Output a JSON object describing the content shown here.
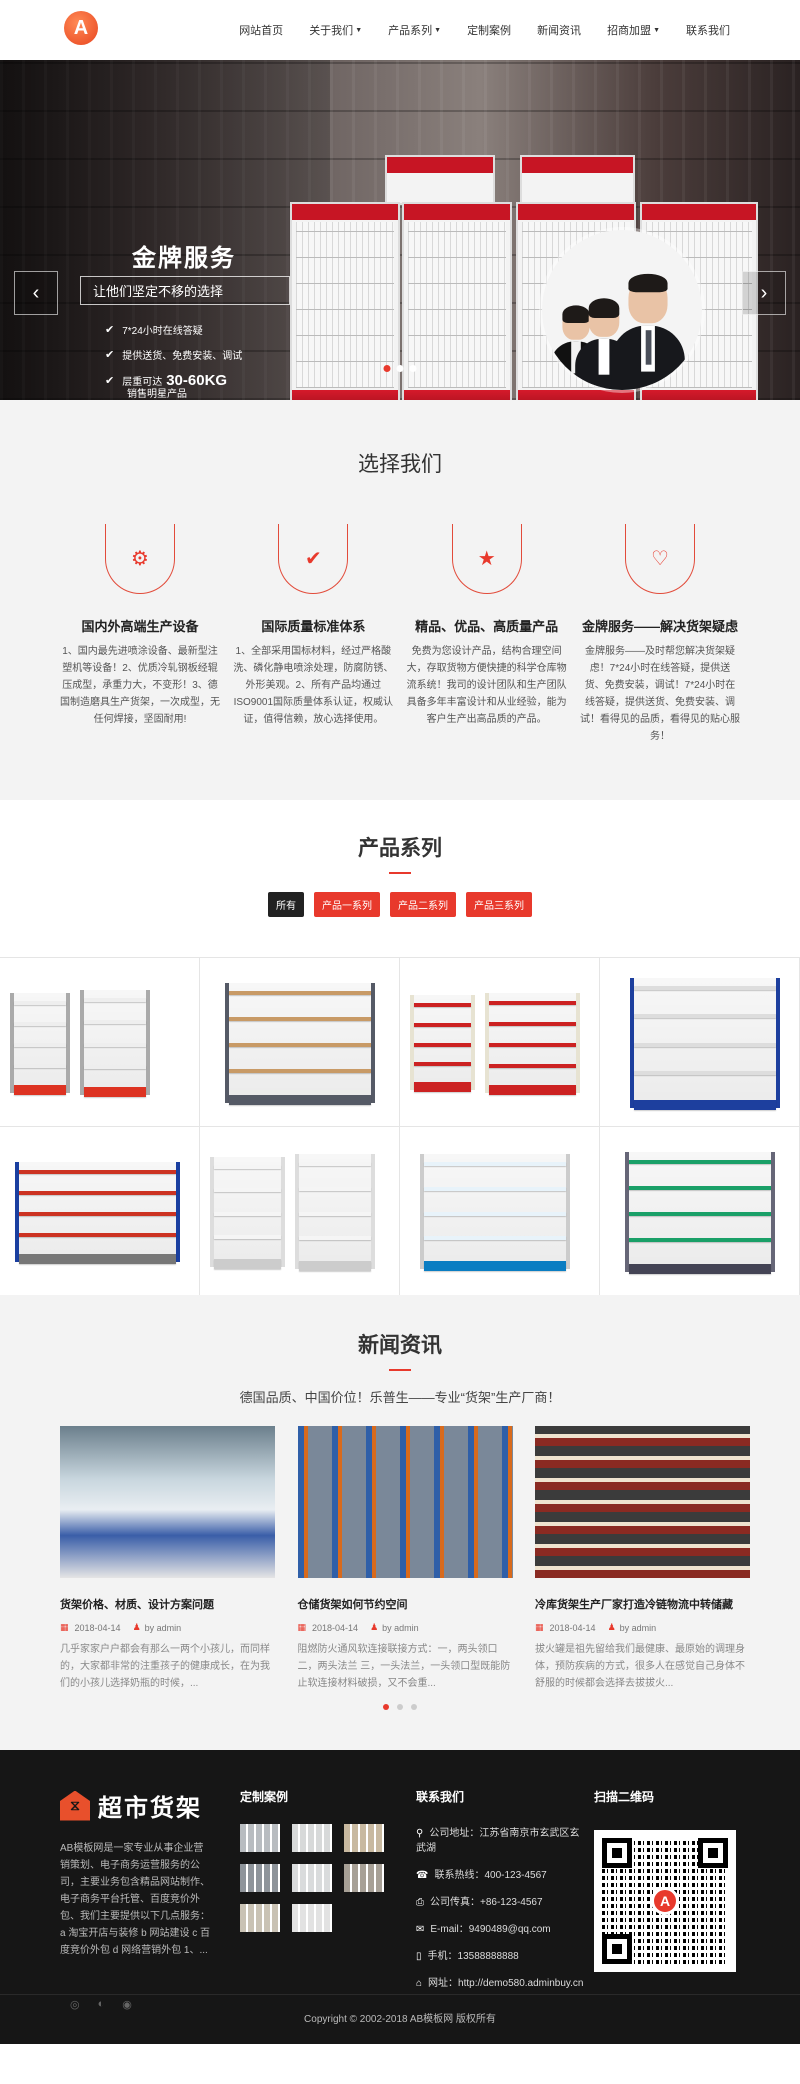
{
  "header": {
    "logo_text": "A",
    "nav": [
      {
        "label": "网站首页",
        "dropdown": false
      },
      {
        "label": "关于我们",
        "dropdown": true
      },
      {
        "label": "产品系列",
        "dropdown": true
      },
      {
        "label": "定制案例",
        "dropdown": false
      },
      {
        "label": "新闻资讯",
        "dropdown": false
      },
      {
        "label": "招商加盟",
        "dropdown": true
      },
      {
        "label": "联系我们",
        "dropdown": false
      }
    ]
  },
  "banner": {
    "title": "金牌服务",
    "subtitle": "让他们坚定不移的选择",
    "points": [
      "7*24小时在线答疑",
      "提供送货、免费安装、调试"
    ],
    "weight_prefix": "层重可达",
    "weight_value": "30-60KG",
    "weight_note": "销售明星产品",
    "prev_icon": "‹",
    "next_icon": "›",
    "slide_count": 3,
    "active_slide": 1
  },
  "choose": {
    "title": "选择我们",
    "items": [
      {
        "icon": "gears-icon",
        "glyph": "⚙",
        "title": "国内外高端生产设备",
        "text": "1、国内最先进喷涂设备、最新型注塑机等设备！2、优质冷轧钢板经辊压成型，承重力大，不变形！3、德国制造磨具生产货架，一次成型，无任何焊接，坚固耐用!"
      },
      {
        "icon": "check-square-icon",
        "glyph": "✔",
        "title": "国际质量标准体系",
        "text": "1、全部采用国标材料，经过严格酸洗、磷化静电喷涂处理，防腐防锈、外形美观。2、所有产品均通过ISO9001国际质量体系认证，权威认证，值得信赖，放心选择使用。"
      },
      {
        "icon": "star-icon",
        "glyph": "★",
        "title": "精品、优品、高质量产品",
        "text": "免费为您设计产品，结构合理空间大，存取货物方便快捷的科学仓库物流系统！我司的设计团队和生产团队具备多年丰富设计和从业经验，能为客户生产出高品质的产品。"
      },
      {
        "icon": "heart-icon",
        "glyph": "♡",
        "title": "金牌服务——解决货架疑虑",
        "text": "金牌服务——及时帮您解决货架疑虑！7*24小时在线答疑，提供送货、免费安装，调试！7*24小时在线答疑，提供送货、免费安装、调试！看得见的品质，看得见的贴心服务！"
      }
    ]
  },
  "products": {
    "title": "产品系列",
    "filters": [
      "所有",
      "产品一系列",
      "产品二系列",
      "产品三系列"
    ],
    "active_filter": 0,
    "items": [
      {
        "kind": "double-white-red"
      },
      {
        "kind": "gondola-wood"
      },
      {
        "kind": "double-cream-red"
      },
      {
        "kind": "blue-steel"
      },
      {
        "kind": "blue-red-heavy"
      },
      {
        "kind": "white-pegboard"
      },
      {
        "kind": "white-glass"
      },
      {
        "kind": "stocked-gondola"
      }
    ]
  },
  "news": {
    "title": "新闻资讯",
    "subtitle": "德国品质、中国价位！乐普生——专业“货架”生产厂商！",
    "items": [
      {
        "title": "货架价格、材质、设计方案问题",
        "date": "2018-04-14",
        "author": "by admin",
        "excerpt": "几乎家家户户都会有那么一两个小孩儿，而同样的，大家都非常的注重孩子的健康成长，在为我们的小孩儿选择奶瓶的时候，..."
      },
      {
        "title": "仓储货架如何节约空间",
        "date": "2018-04-14",
        "author": "by admin",
        "excerpt": "阻燃防火通风软连接联接方式：一，两头领口 二，两头法兰 三，一头法兰，一头领口型既能防止软连接材料破损，又不会重..."
      },
      {
        "title": "冷库货架生产厂家打造冷链物流中转储藏",
        "date": "2018-04-14",
        "author": "by admin",
        "excerpt": "拔火罐是祖先留给我们最健康、最原始的调理身体，预防疾病的方式，很多人在感觉自己身体不舒服的时候都会选择去拔拔火..."
      }
    ],
    "dot_count": 3,
    "active_dot": 0
  },
  "footer": {
    "brand_name": "超市货架",
    "about": "AB模板网是一家专业从事企业营销策划、电子商务运营服务的公司，主要业务包含精品网站制作、电子商务平台托管、百度竞价外包、我们主要提供以下几点服务： a 淘宝开店与装修 b 网站建设 c 百度竞价外包 d 网络营销外包 1、...",
    "cases_title": "定制案例",
    "contact_title": "联系我们",
    "qr_title": "扫描二维码",
    "contact": [
      {
        "icon": "map-marker-icon",
        "glyph": "⚲",
        "label": "公司地址：",
        "value": "江苏省南京市玄武区玄武湖"
      },
      {
        "icon": "phone-icon",
        "glyph": "☎",
        "label": "联系热线：",
        "value": "400-123-4567"
      },
      {
        "icon": "fax-icon",
        "glyph": "⎙",
        "label": "公司传真：",
        "value": "+86-123-4567"
      },
      {
        "icon": "mail-icon",
        "glyph": "✉",
        "label": "E-mail：",
        "value": "9490489@qq.com"
      },
      {
        "icon": "mobile-icon",
        "glyph": "▯",
        "label": "手机：",
        "value": "13588888888"
      },
      {
        "icon": "home-icon",
        "glyph": "⌂",
        "label": "网址：",
        "value": "http://demo580.adminbuy.cn"
      }
    ],
    "social": [
      {
        "icon": "weibo-icon",
        "glyph": "◎"
      },
      {
        "icon": "wechat-icon",
        "glyph": "◐"
      },
      {
        "icon": "qq-icon",
        "glyph": "◉"
      }
    ],
    "copyright": "Copyright © 2002-2018 AB模板网 版权所有"
  },
  "colors": {
    "accent": "#e8392c",
    "dark": "#161616",
    "section_bg": "#f3f3f3"
  }
}
